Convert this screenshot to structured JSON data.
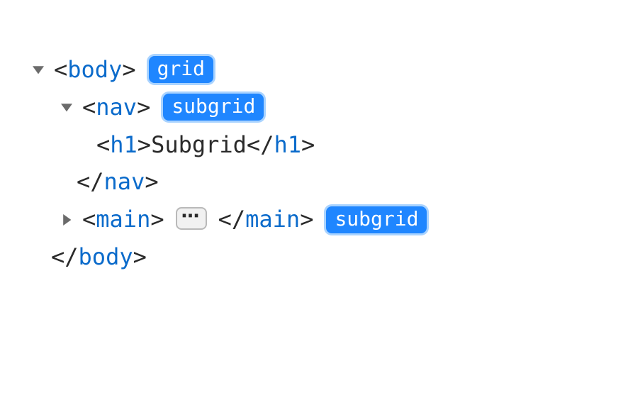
{
  "tags": {
    "body": "body",
    "nav": "nav",
    "h1": "h1",
    "main": "main"
  },
  "punct": {
    "lt": "<",
    "gt": ">",
    "ltc": "</"
  },
  "text": {
    "h1_content": "Subgrid",
    "ellipsis": "⋯"
  },
  "badges": {
    "grid": "grid",
    "subgrid_nav": "subgrid",
    "subgrid_main": "subgrid"
  }
}
